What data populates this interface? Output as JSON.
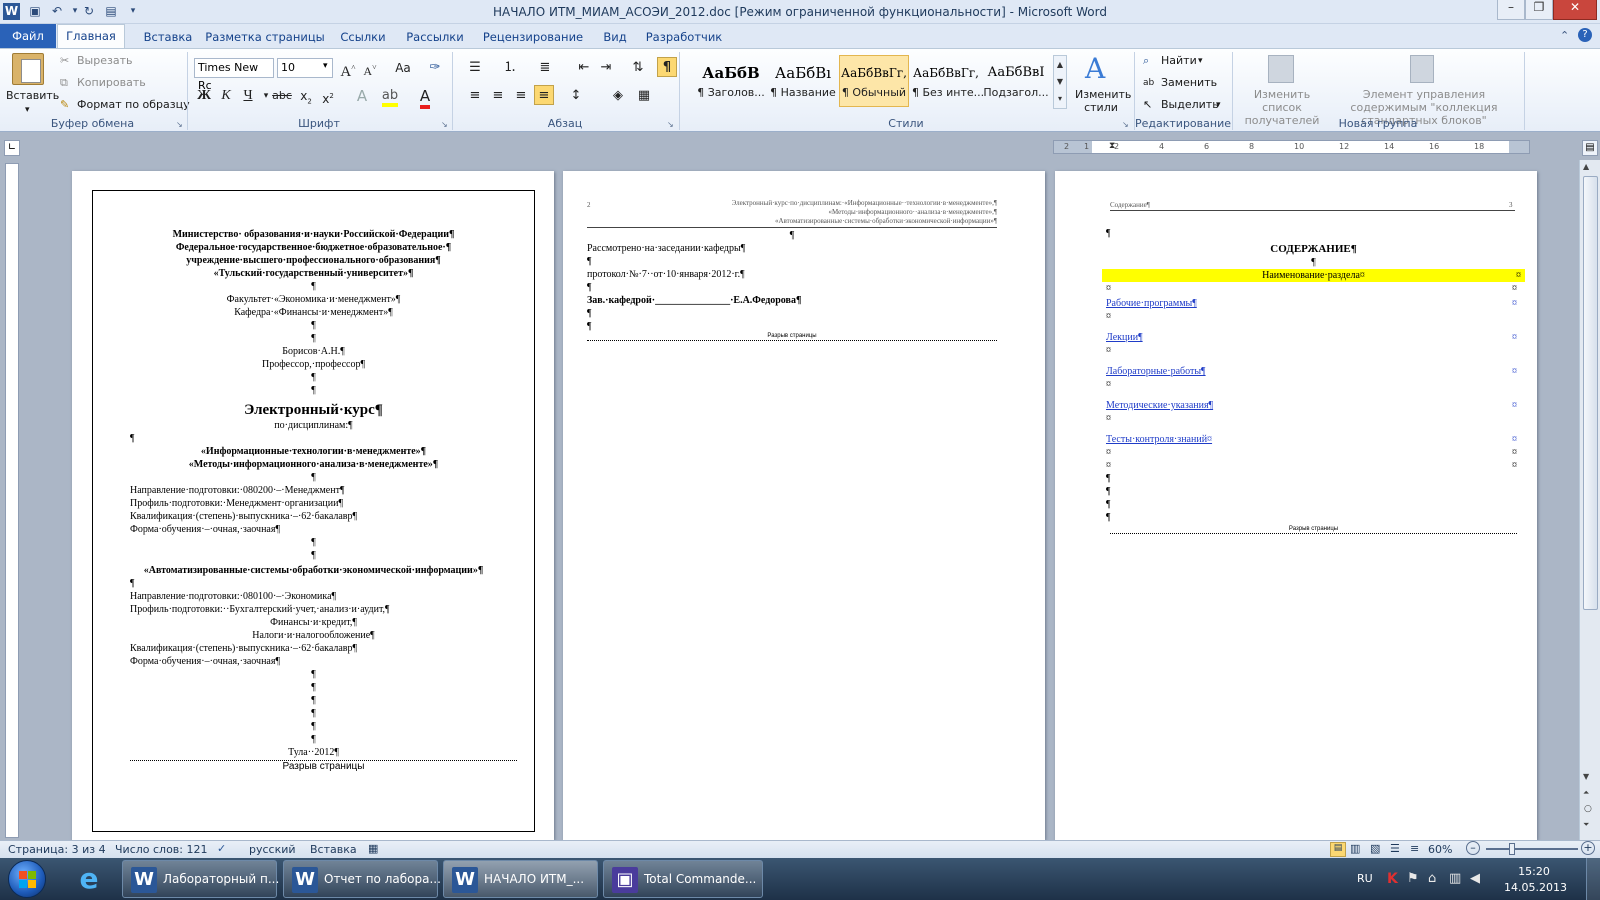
{
  "window": {
    "title": "НАЧАЛО ИТМ_МИАМ_АСОЭИ_2012.doc [Режим ограниченной функциональности]  -  Microsoft Word"
  },
  "tabs": [
    "Файл",
    "Главная",
    "Вставка",
    "Разметка страницы",
    "Ссылки",
    "Рассылки",
    "Рецензирование",
    "Вид",
    "Разработчик"
  ],
  "ribbon": {
    "clipboard": {
      "paste": "Вставить",
      "cut": "Вырезать",
      "copy": "Копировать",
      "format_painter": "Формат по образцу",
      "label": "Буфер обмена"
    },
    "font": {
      "name": "Times New Rc",
      "size": "10",
      "label": "Шрифт",
      "bold": "Ж",
      "italic": "К",
      "underline": "Ч"
    },
    "paragraph": {
      "label": "Абзац"
    },
    "styles": {
      "label": "Стили",
      "items": [
        {
          "preview": "АаБбВ",
          "name": "¶ Заголов..."
        },
        {
          "preview": "АаБбВı",
          "name": "¶ Название"
        },
        {
          "preview": "АаБбВвГг,",
          "name": "¶ Обычный"
        },
        {
          "preview": "АаБбВвГг,",
          "name": "¶ Без инте..."
        },
        {
          "preview": "АаБбВвІ",
          "name": "Подзагол..."
        }
      ],
      "change_styles": "Изменить стили"
    },
    "editing": {
      "find": "Найти",
      "replace": "Заменить",
      "select": "Выделить",
      "label": "Редактирование"
    },
    "new_group": {
      "change_list": "Изменить список получателей",
      "blocks": "Элемент управления содержимым \"коллекция стандартных блоков\"",
      "label": "Новая группа"
    }
  },
  "page1": {
    "lines": [
      "Министерство· образования·и·науки·Российской·Федерации¶",
      "Федеральное·государственное·бюджетное·образовательное·¶",
      "учреждение·высшего·профессионального·образования¶",
      "«Тульский·государственный·университет»¶",
      "¶",
      "Факультет·«Экономика·и·менеджмент»¶",
      "Кафедра·«Финансы·и·менеджмент»¶",
      "¶",
      "¶",
      "Борисов·А.Н.¶",
      "Профессор,·профессор¶",
      "¶",
      "¶",
      "Электронный·курс¶",
      "по·дисциплинам:¶",
      "¶",
      "«Информационные·технологии·в·менеджменте»¶",
      "«Методы·информационного·анализа·в·менеджменте»¶",
      "¶",
      "Направление·подготовки:·080200·–·Менеджмент¶",
      "Профиль·подготовки:·Менеджмент·организации¶",
      "Квалификация·(степень)·выпускника·–·62·бакалавр¶",
      "Форма·обучения·–·очная,·заочная¶",
      "¶",
      "¶",
      "«Автоматизированные·системы·обработки·экономической·информации»¶",
      "¶",
      "Направление·подготовки:·080100·–·Экономика¶",
      "Профиль·подготовки:··Бухгалтерский·учет,·анализ·и·аудит,¶",
      "Финансы·и·кредит,¶",
      "Налоги·и·налогообложение¶",
      "Квалификация·(степень)·выпускника·–·62·бакалавр¶",
      "Форма·обучения·–·очная,·заочная¶",
      "¶",
      "¶",
      "¶",
      "¶",
      "¶",
      "¶",
      "Тула··2012¶",
      "Разрыв страницы"
    ]
  },
  "page2": {
    "page_num": "2",
    "header": [
      "Электронный·курс·по·дисциплинам:·«Информационные··технологии·в·менеджменте»,¶",
      "«Методы·информационного··анализа·в·менеджменте»,¶",
      "«Автоматизированные·системы·обработки·экономической·информации»¶"
    ],
    "lines": [
      "¶",
      "Рассмотрено·на·заседании·кафедры¶",
      "¶",
      "протокол·№·7··от·10·января·2012·г.¶",
      "¶",
      "Зав.·кафедрой·_______________·Е.А.Федорова¶",
      "¶",
      "¶",
      "Разрыв страницы"
    ]
  },
  "page3": {
    "header_left": "Содержание¶",
    "page_num": "3",
    "lines": [
      "¶",
      "СОДЕРЖАНИЕ¶",
      "¶",
      "Наименование·раздела¤",
      "¤",
      "Рабочие·программы¶",
      "¤",
      "Лекции¶",
      "¤",
      "Лабораторные·работы¶",
      "¤",
      "Методические·указания¶",
      "¤",
      "Тесты·контроля·знаний¤",
      "¤",
      "¤",
      "¶",
      "¶",
      "¶",
      "¶",
      "Разрыв страницы"
    ],
    "cell_mark": "¤"
  },
  "ruler_ticks": [
    "2",
    "1",
    "2",
    "4",
    "6",
    "8",
    "10",
    "12",
    "14",
    "16",
    "18"
  ],
  "status": {
    "page": "Страница: 3 из 4",
    "words": "Число слов: 121",
    "lang": "русский",
    "mode": "Вставка",
    "zoom": "60%"
  },
  "taskbar": {
    "items": [
      {
        "icon": "W",
        "label": "Лабораторный п..."
      },
      {
        "icon": "W",
        "label": "Отчет по лабора..."
      },
      {
        "icon": "W",
        "label": "НАЧАЛО ИТМ_..."
      },
      {
        "icon": "▣",
        "label": "Total Commande..."
      }
    ],
    "lang": "RU",
    "time": "15:20",
    "date": "14.05.2013"
  }
}
